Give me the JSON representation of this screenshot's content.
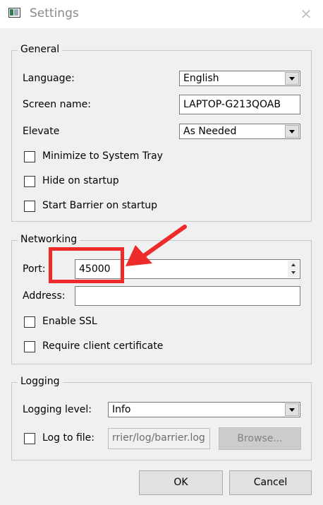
{
  "window": {
    "title": "Settings",
    "close_glyph": "✕",
    "icon": "barrier-app-icon"
  },
  "general": {
    "title": "General",
    "language_label": "Language:",
    "language_value": "English",
    "screen_name_label": "Screen name:",
    "screen_name_value": "LAPTOP-G213QOAB",
    "elevate_label": "Elevate",
    "elevate_value": "As Needed",
    "minimize_tray_label": "Minimize to System Tray",
    "hide_startup_label": "Hide on startup",
    "start_barrier_label": "Start Barrier on startup"
  },
  "networking": {
    "title": "Networking",
    "port_label": "Port:",
    "port_value": "45000",
    "address_label": "Address:",
    "address_value": "",
    "enable_ssl_label": "Enable SSL",
    "require_cert_label": "Require client certificate"
  },
  "logging": {
    "title": "Logging",
    "level_label": "Logging level:",
    "level_value": "Info",
    "log_to_file_label": "Log to file:",
    "log_file_value": "rrier/log/barrier.log",
    "browse_label": "Browse..."
  },
  "buttons": {
    "ok_label": "OK",
    "cancel_label": "Cancel"
  },
  "annotation": {
    "color": "#ee2b2b"
  }
}
